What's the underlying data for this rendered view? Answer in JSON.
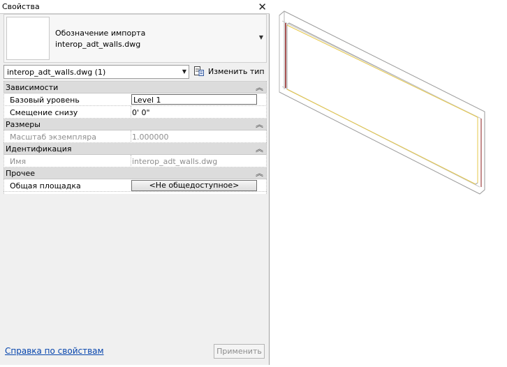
{
  "panel": {
    "title": "Свойства",
    "type_name_line1": "Обозначение импорта",
    "type_name_line2": "interop_adt_walls.dwg",
    "instance_selector": "interop_adt_walls.dwg (1)",
    "edit_type_label": "Изменить тип"
  },
  "groups": [
    {
      "label": "Зависимости",
      "rows": [
        {
          "key": "Базовый уровень",
          "value": "Level 1"
        },
        {
          "key": "Смещение снизу",
          "value": "0'  0\""
        }
      ]
    },
    {
      "label": "Размеры",
      "rows": [
        {
          "key": "Масштаб экземпляра",
          "value": "1.000000"
        }
      ]
    },
    {
      "label": "Идентификация",
      "rows": [
        {
          "key": "Имя",
          "value": "interop_adt_walls.dwg"
        }
      ]
    },
    {
      "label": "Прочее",
      "rows": [
        {
          "key": "Общая площадка",
          "value": "<Не общедоступное>"
        }
      ]
    }
  ],
  "footer": {
    "help_link": "Справка по свойствам",
    "apply_label": "Применить"
  },
  "icons": {
    "close": "close-icon",
    "collapse": "collapse-chevrons-icon",
    "dropdown": "chevron-down-icon",
    "edit_type": "edit-type-icon"
  },
  "colors": {
    "link": "#0645ad",
    "group_header_bg": "#dcdcdc",
    "wall_accent": "#8b1a1a",
    "wall_yellow": "#e6c84a"
  }
}
